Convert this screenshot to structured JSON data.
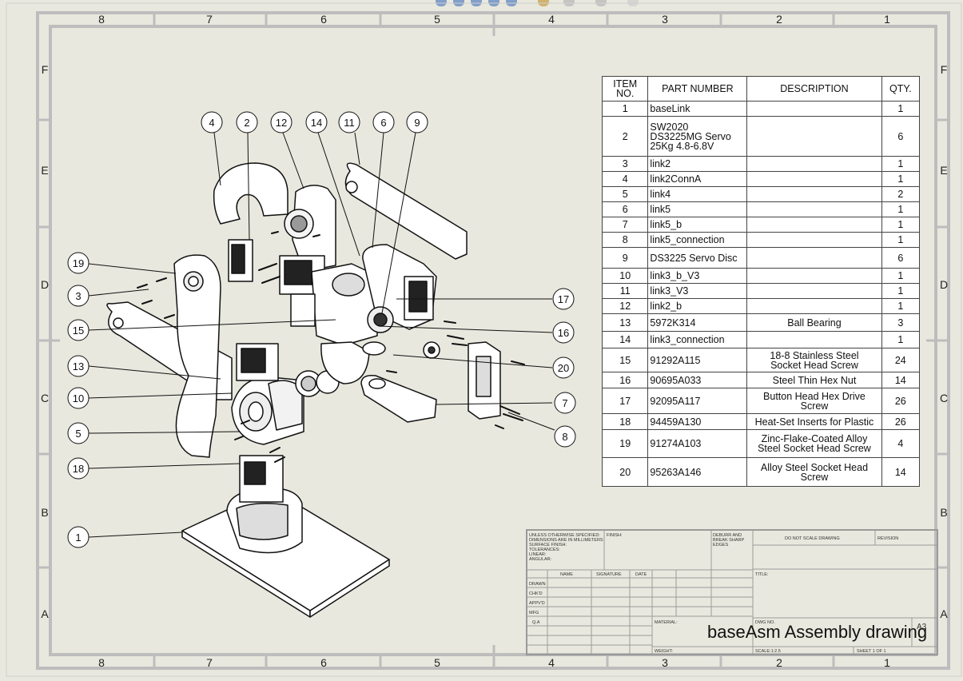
{
  "zone_columns": [
    "8",
    "7",
    "6",
    "5",
    "4",
    "3",
    "2",
    "1"
  ],
  "zone_rows": [
    "F",
    "E",
    "D",
    "C",
    "B",
    "A"
  ],
  "bom": {
    "headers": [
      "ITEM\nNO.",
      "PART NUMBER",
      "DESCRIPTION",
      "QTY."
    ],
    "rows": [
      {
        "item": "1",
        "part": "baseLink",
        "desc": "",
        "qty": "1"
      },
      {
        "item": "2",
        "part": "SW2020\nDS3225MG Servo\n25Kg 4.8-6.8V",
        "desc": "",
        "qty": "6"
      },
      {
        "item": "3",
        "part": "link2",
        "desc": "",
        "qty": "1"
      },
      {
        "item": "4",
        "part": "link2ConnA",
        "desc": "",
        "qty": "1"
      },
      {
        "item": "5",
        "part": "link4",
        "desc": "",
        "qty": "2"
      },
      {
        "item": "6",
        "part": "link5",
        "desc": "",
        "qty": "1"
      },
      {
        "item": "7",
        "part": "link5_b",
        "desc": "",
        "qty": "1"
      },
      {
        "item": "8",
        "part": "link5_connection",
        "desc": "",
        "qty": "1"
      },
      {
        "item": "9",
        "part": "DS3225 Servo Disc",
        "desc": "",
        "qty": "6"
      },
      {
        "item": "10",
        "part": "link3_b_V3",
        "desc": "",
        "qty": "1"
      },
      {
        "item": "11",
        "part": "link3_V3",
        "desc": "",
        "qty": "1"
      },
      {
        "item": "12",
        "part": "link2_b",
        "desc": "",
        "qty": "1"
      },
      {
        "item": "13",
        "part": "5972K314",
        "desc": "Ball Bearing",
        "qty": "3"
      },
      {
        "item": "14",
        "part": "link3_connection",
        "desc": "",
        "qty": "1"
      },
      {
        "item": "15",
        "part": "91292A115",
        "desc": "18-8 Stainless Steel\nSocket Head Screw",
        "qty": "24"
      },
      {
        "item": "16",
        "part": "90695A033",
        "desc": "Steel Thin Hex Nut",
        "qty": "14"
      },
      {
        "item": "17",
        "part": "92095A117",
        "desc": "Button Head Hex Drive\nScrew",
        "qty": "26"
      },
      {
        "item": "18",
        "part": "94459A130",
        "desc": "Heat-Set Inserts for Plastic",
        "qty": "26"
      },
      {
        "item": "19",
        "part": "91274A103",
        "desc": "Zinc-Flake-Coated Alloy\nSteel Socket Head Screw",
        "qty": "4"
      },
      {
        "item": "20",
        "part": "95263A146",
        "desc": "Alloy Steel Socket Head\nScrew",
        "qty": "14"
      }
    ]
  },
  "balloons": [
    "4",
    "2",
    "12",
    "14",
    "11",
    "6",
    "9",
    "19",
    "3",
    "15",
    "13",
    "10",
    "5",
    "18",
    "1",
    "17",
    "16",
    "20",
    "7",
    "8"
  ],
  "title_block": {
    "notes": "UNLESS OTHERWISE SPECIFIED:\nDIMENSIONS ARE IN MILLIMETERS\nSURFACE FINISH:\nTOLERANCES:\n  LINEAR:\n  ANGULAR:",
    "finish": "FINISH:",
    "deburr": "DEBURR AND\nBREAK SHARP\nEDGES",
    "do_not_scale": "DO NOT SCALE DRAWING",
    "revision": "REVISION",
    "col_name": "NAME",
    "col_signature": "SIGNATURE",
    "col_date": "DATE",
    "row_drawn": "DRAWN",
    "row_chkd": "CHK'D",
    "row_appvd": "APPV'D",
    "row_mfg": "MFG",
    "row_qa": "Q.A",
    "title_label": "TITLE:",
    "material": "MATERIAL:",
    "dwg_no": "DWG NO.",
    "weight": "WEIGHT:",
    "scale": "SCALE:1:2.5",
    "sheet": "SHEET 1 OF 1",
    "sheet_size": "A3",
    "drawing_title": "baseAsm Assembly drawing"
  }
}
